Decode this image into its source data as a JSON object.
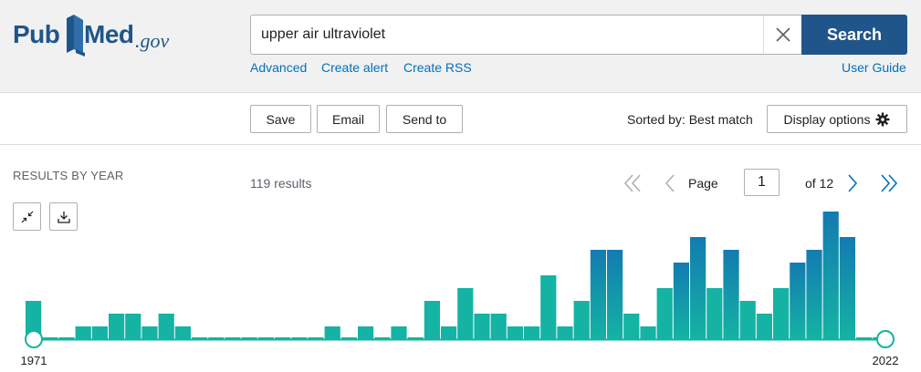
{
  "header": {
    "logo": {
      "part1": "Pub",
      "part2": "Med",
      "suffix": ".gov"
    },
    "search": {
      "value": "upper air ultraviolet",
      "placeholder": ""
    },
    "search_button": "Search",
    "links": {
      "advanced": "Advanced",
      "create_alert": "Create alert",
      "create_rss": "Create RSS",
      "user_guide": "User Guide"
    }
  },
  "toolbar": {
    "save": "Save",
    "email": "Email",
    "send_to": "Send to",
    "sorted_by": "Sorted by: Best match",
    "display_options": "Display options"
  },
  "results": {
    "section_title": "RESULTS BY YEAR",
    "count": "119 results",
    "page_label": "Page",
    "page_value": "1",
    "of_label": "of 12"
  },
  "colors": {
    "brand_blue": "#20558a",
    "link_blue": "#0071bc",
    "bar_teal": "#14b3a3",
    "bar_blue": "#137bb1"
  },
  "chart_data": {
    "type": "bar",
    "title": "",
    "xlabel": "",
    "ylabel": "",
    "x": [
      1971,
      1972,
      1973,
      1974,
      1975,
      1976,
      1977,
      1978,
      1979,
      1980,
      1981,
      1982,
      1983,
      1984,
      1985,
      1986,
      1987,
      1988,
      1989,
      1990,
      1991,
      1992,
      1993,
      1994,
      1995,
      1996,
      1997,
      1998,
      1999,
      2000,
      2001,
      2002,
      2003,
      2004,
      2005,
      2006,
      2007,
      2008,
      2009,
      2010,
      2011,
      2012,
      2013,
      2014,
      2015,
      2016,
      2017,
      2018,
      2019,
      2020,
      2021,
      2022
    ],
    "values": [
      3,
      0,
      0,
      1,
      1,
      2,
      2,
      1,
      2,
      1,
      0,
      0,
      0,
      0,
      0,
      0,
      0,
      0,
      1,
      0,
      1,
      0,
      1,
      0,
      3,
      1,
      4,
      2,
      2,
      1,
      1,
      5,
      1,
      3,
      7,
      7,
      2,
      1,
      4,
      6,
      8,
      4,
      7,
      3,
      2,
      4,
      6,
      7,
      10,
      8,
      0,
      0
    ],
    "highlight_from_index": 34,
    "range_labels": {
      "start": "1971",
      "end": "2022"
    }
  }
}
